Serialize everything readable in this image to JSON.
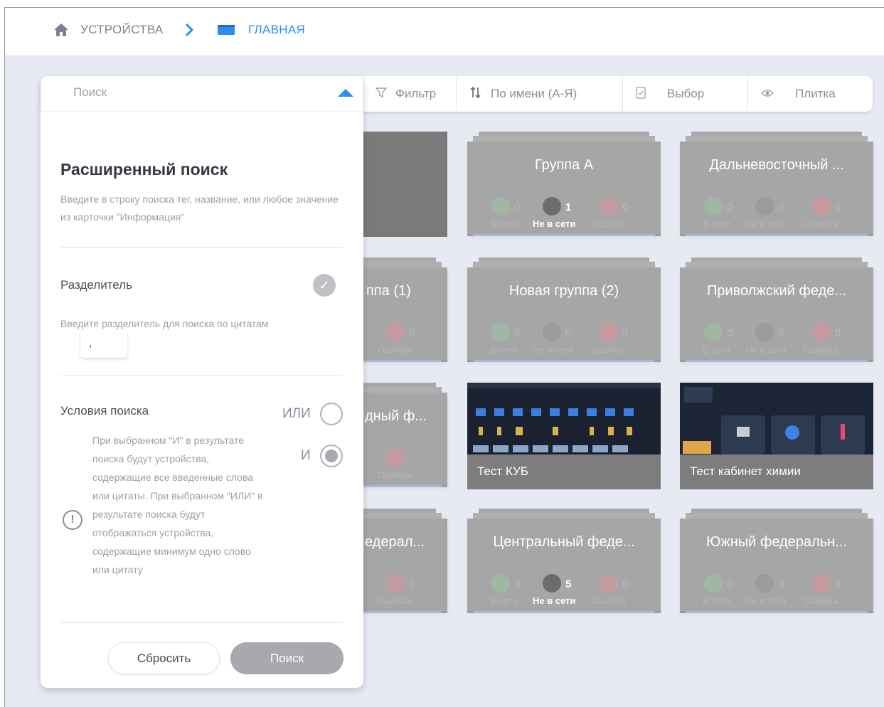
{
  "breadcrumb": {
    "devices": "УСТРОЙСТВА",
    "separator": ">",
    "current": "ГЛАВНАЯ"
  },
  "toolbar": {
    "filter": "Фильтр",
    "sort": "По имени (А-Я)",
    "select": "Выбор",
    "view": "Плитка"
  },
  "status_labels": {
    "online": "В сети",
    "offline": "Не в сети",
    "error": "Ошибка"
  },
  "cards": {
    "group_a": {
      "title": "Группа А",
      "online": "0",
      "offline": "1",
      "error": "0"
    },
    "far_east": {
      "title": "Дальневосточный ...",
      "online": "0",
      "offline": "0",
      "error": "0"
    },
    "partial_1": {
      "title": "ппа (1)",
      "error": "0"
    },
    "new_group_2": {
      "title": "Новая группа (2)",
      "online": "0",
      "offline": "0",
      "error": "0"
    },
    "volga": {
      "title": "Приволжский феде...",
      "online": "0",
      "offline": "0",
      "error": "0"
    },
    "partial_2": {
      "title": "дный ф...",
      "error": "0"
    },
    "test_kub": {
      "title": "Тест КУБ"
    },
    "test_chem": {
      "title": "Тест кабинет химии"
    },
    "partial_3": {
      "title": "едерал...",
      "error": "0"
    },
    "central": {
      "title": "Центральный феде...",
      "online": "0",
      "offline": "5",
      "error": "0"
    },
    "south": {
      "title": "Южный федеральн...",
      "online": "0",
      "offline": "0",
      "error": "0"
    }
  },
  "panel": {
    "search_placeholder": "Поиск",
    "title": "Расширенный поиск",
    "description": "Введите в строку поиска тег, название, или любое значение из карточки \"Информация\"",
    "separator_label": "Разделитель",
    "separator_desc": "Введите разделитель для поиска по цитатам",
    "separator_value": ",",
    "conditions_label": "Условия поиска",
    "option_or": "ИЛИ",
    "option_and": "И",
    "selected_option": "И",
    "info": "При выбранном \"И\" в результате поиска будут устройства, содержащие все введенные слова или цитаты. При выбранном \"ИЛИ\" в результате поиска будут отображаться устройства, содержащие минимум одно слово или цитату",
    "reset_button": "Сбросить",
    "search_button": "Поиск"
  },
  "colors": {
    "accent": "#2d8cf0",
    "card": "#a6a6a6",
    "background": "#e8eaf3"
  }
}
